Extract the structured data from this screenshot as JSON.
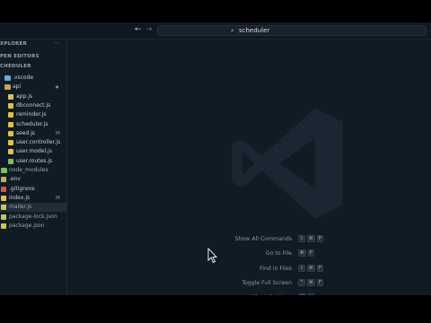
{
  "titlebar": {
    "back_arrow": "←",
    "forward_arrow": "→",
    "search_icon": "⌕",
    "project_name": "scheduler"
  },
  "sidebar": {
    "explorer_title": "XPLORER",
    "more_actions": "···",
    "open_editors_title": "PEN EDITORS",
    "project_title": "CHEDULER",
    "items": [
      {
        "label": ".vscode",
        "icon": "folder-icon",
        "color": "#6aa6d8",
        "badge": ""
      },
      {
        "label": "api",
        "icon": "folder-icon",
        "color": "#d0a34a",
        "badge": "●"
      },
      {
        "label": "app.js",
        "icon": "js-file-icon",
        "color": "#e2c04a",
        "badge": ""
      },
      {
        "label": "dbconnect.js",
        "icon": "js-file-icon",
        "color": "#e2c04a",
        "badge": ""
      },
      {
        "label": "reminder.js",
        "icon": "js-file-icon",
        "color": "#e2c04a",
        "badge": ""
      },
      {
        "label": "scheduler.js",
        "icon": "js-file-icon",
        "color": "#e2c04a",
        "badge": ""
      },
      {
        "label": "seed.js",
        "icon": "js-file-icon",
        "color": "#e2c04a",
        "badge": "M"
      },
      {
        "label": "user.controller.js",
        "icon": "js-file-icon",
        "color": "#e2c04a",
        "badge": ""
      },
      {
        "label": "user.model.js",
        "icon": "js-file-icon",
        "color": "#e2c04a",
        "badge": ""
      },
      {
        "label": "user.routes.js",
        "icon": "routes-file-icon",
        "color": "#7cc25a",
        "badge": ""
      },
      {
        "label": "node_modules",
        "icon": "folder-icon",
        "color": "#7cc25a",
        "badge": ""
      },
      {
        "label": ".env",
        "icon": "env-file-icon",
        "color": "#c9b24a",
        "badge": ""
      },
      {
        "label": ".gitignore",
        "icon": "git-file-icon",
        "color": "#e0583b",
        "badge": ""
      },
      {
        "label": "index.js",
        "icon": "js-file-icon",
        "color": "#e2c04a",
        "badge": "M"
      },
      {
        "label": "mailer.js",
        "icon": "js-file-icon",
        "color": "#e2c04a",
        "badge": "",
        "active": true
      },
      {
        "label": "package-lock.json",
        "icon": "json-file-icon",
        "color": "#c9c94a",
        "badge": ""
      },
      {
        "label": "package.json",
        "icon": "json-file-icon",
        "color": "#c9c94a",
        "badge": ""
      }
    ]
  },
  "shortcuts": [
    {
      "label": "Show All Commands",
      "keys": [
        "⇧",
        "⌘",
        "P"
      ]
    },
    {
      "label": "Go to File",
      "keys": [
        "⌘",
        "P"
      ]
    },
    {
      "label": "Find in Files",
      "keys": [
        "⇧",
        "⌘",
        "F"
      ]
    },
    {
      "label": "Toggle Full Screen",
      "keys": [
        "^",
        "⌘",
        "F"
      ]
    },
    {
      "label": "Show Settings",
      "keys": [
        "⌘",
        ","
      ]
    }
  ],
  "colors": {
    "background": "#111b24",
    "outer": "#000000",
    "watermark": "#1a2732"
  }
}
